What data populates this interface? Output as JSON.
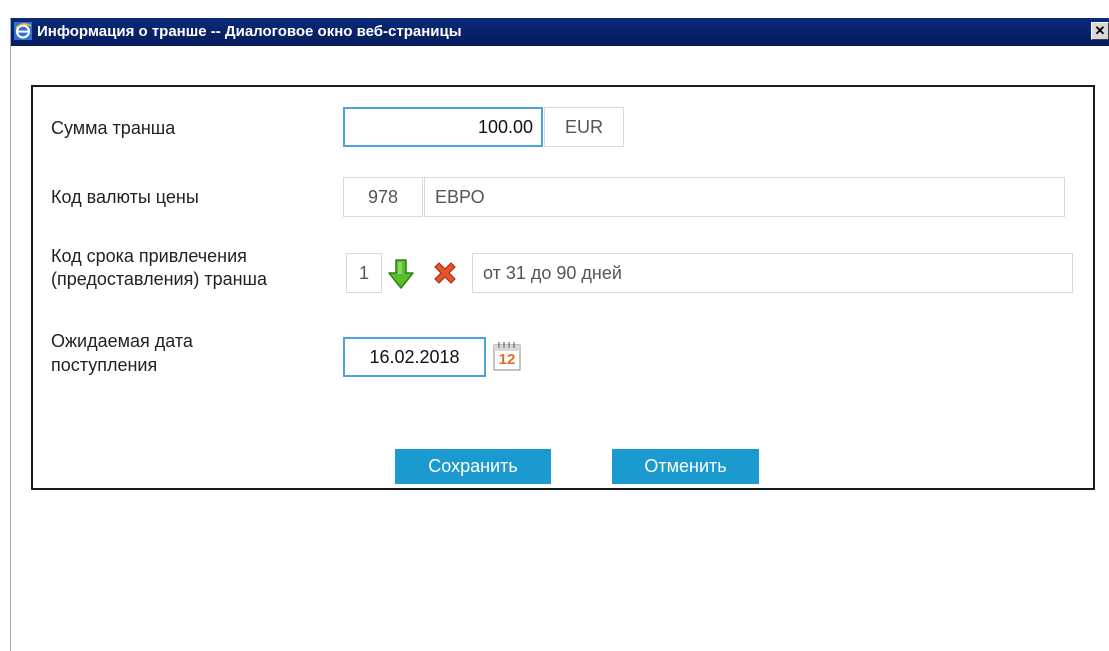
{
  "window": {
    "title": "Информация о транше -- Диалоговое окно веб-страницы",
    "close_glyph": "✕",
    "icon": "ie-icon"
  },
  "form": {
    "amount": {
      "label": "Сумма транша",
      "value": "100.00",
      "currency": "EUR"
    },
    "currency_code": {
      "label": "Код валюты цены",
      "code": "978",
      "name": "ЕВРО"
    },
    "term_code": {
      "label_line1": "Код срока привлечения",
      "label_line2": "(предоставления) транша",
      "code": "1",
      "description": "от 31 до 90 дней"
    },
    "expected_date": {
      "label_line1": "Ожидаемая дата",
      "label_line2": "поступления",
      "value": "16.02.2018",
      "calendar_day": "12"
    }
  },
  "buttons": {
    "save": "Сохранить",
    "cancel": "Отменить"
  },
  "colors": {
    "titlebar": "#0a2a7a",
    "button": "#1a9acf",
    "focus_border": "#4ba2d6"
  }
}
